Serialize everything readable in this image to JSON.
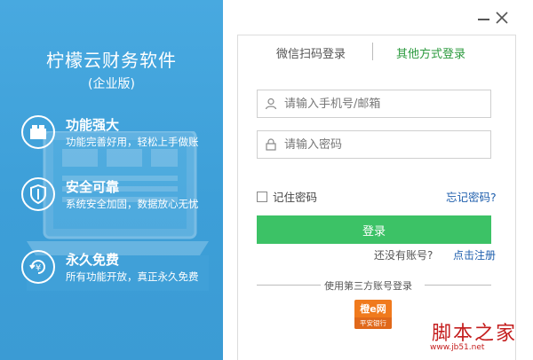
{
  "brand": {
    "title": "柠檬云财务软件",
    "subtitle": "(企业版)"
  },
  "features": [
    {
      "icon": "module-icon",
      "title": "功能强大",
      "desc": "功能完善好用，轻松上手做账"
    },
    {
      "icon": "shield-icon",
      "title": "安全可靠",
      "desc": "系统安全加固，数据放心无忧"
    },
    {
      "icon": "yuan-cycle-icon",
      "title": "永久免费",
      "desc": "所有功能开放，真正永久免费"
    }
  ],
  "window": {
    "minimize_icon": "minimize-icon",
    "close_icon": "close-icon"
  },
  "tabs": {
    "wechat": "微信扫码登录",
    "other": "其他方式登录",
    "active": "other",
    "active_color": "#2b9a3e"
  },
  "form": {
    "account_placeholder": "请输入手机号/邮箱",
    "account_value": "",
    "password_placeholder": "请输入密码",
    "password_value": "",
    "remember_label": "记住密码",
    "remember_checked": false,
    "forgot_label": "忘记密码?",
    "login_label": "登录",
    "login_color": "#3cc266",
    "no_account_text": "还没有账号?",
    "register_label": "点击注册"
  },
  "third_party": {
    "label": "使用第三方账号登录",
    "bank_logo_top": "橙e网",
    "bank_logo_bottom": "平安银行"
  },
  "watermark": {
    "text": "脚本之家",
    "url": "www.jb51.net"
  }
}
